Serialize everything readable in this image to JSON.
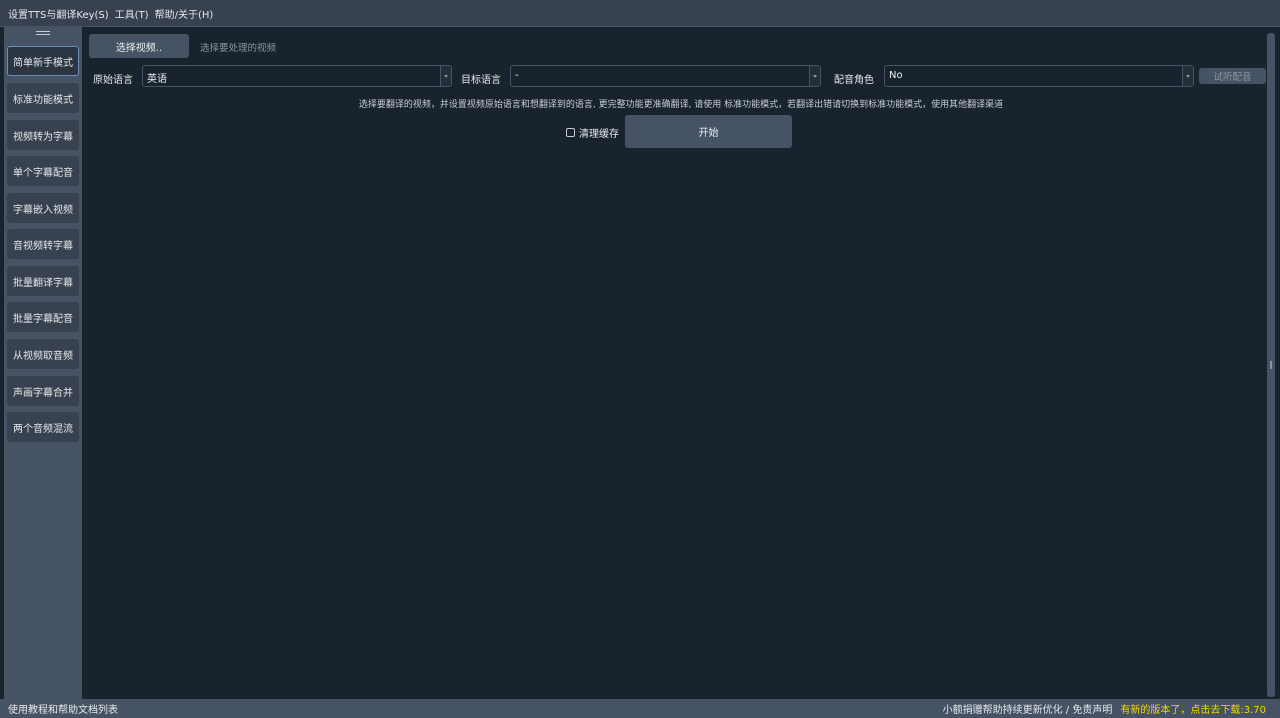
{
  "menubar": {
    "items": [
      "设置TTS与翻译Key(S)",
      "工具(T)",
      "帮助/关于(H)"
    ]
  },
  "sidebar": {
    "items": [
      {
        "label": "简单新手模式",
        "active": true
      },
      {
        "label": "标准功能模式"
      },
      {
        "label": "视频转为字幕"
      },
      {
        "label": "单个字幕配音"
      },
      {
        "label": "字幕嵌入视频"
      },
      {
        "label": "音视频转字幕"
      },
      {
        "label": "批量翻译字幕"
      },
      {
        "label": "批量字幕配音"
      },
      {
        "label": "从视频取音频"
      },
      {
        "label": "声画字幕合并"
      },
      {
        "label": "两个音频混流"
      }
    ]
  },
  "main": {
    "select_video_label": "选择视频..",
    "select_video_hint": "选择要处理的视频",
    "source_lang_label": "原始语言",
    "source_lang_value": "英语",
    "target_lang_label": "目标语言",
    "target_lang_value": "-",
    "voice_role_label": "配音角色",
    "voice_role_value": "No",
    "listen_button": "试听配音",
    "description": "选择要翻译的视频，并设置视频原始语言和想翻译到的语言, 更完整功能更准确翻译, 请使用 标准功能模式，若翻译出错请切换到标准功能模式，使用其他翻译渠道",
    "clear_cache_label": "清理缓存",
    "start_button": "开始"
  },
  "statusbar": {
    "left": "使用教程和帮助文档列表",
    "donate": "小额捐赠帮助持续更新优化 / 免责声明",
    "update": "有新的版本了，点击去下载:3.70"
  }
}
